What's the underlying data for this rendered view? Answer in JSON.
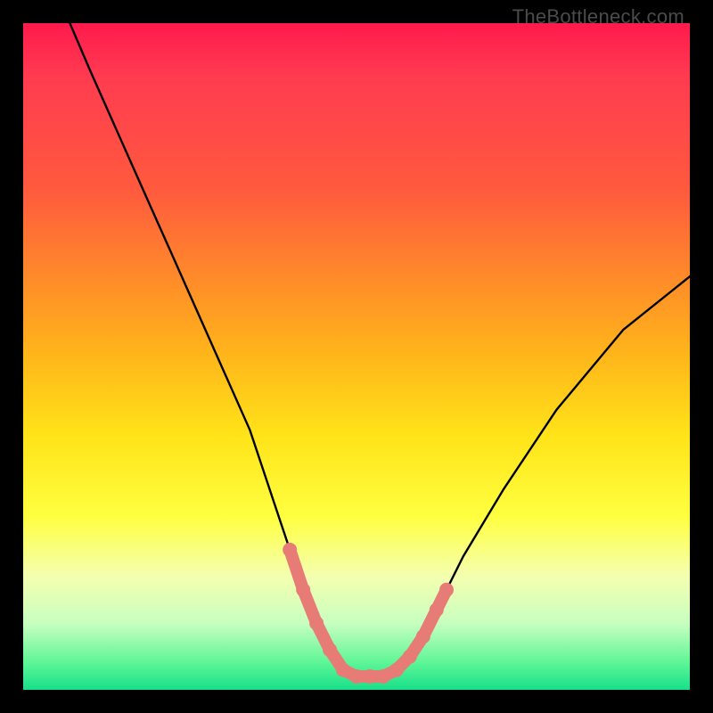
{
  "watermark": "TheBottleneck.com",
  "chart_data": {
    "type": "line",
    "title": "",
    "xlabel": "",
    "ylabel": "",
    "xlim": [
      0,
      100
    ],
    "ylim": [
      0,
      100
    ],
    "background_gradient_stops": [
      {
        "pos": 0,
        "color": "#ff1a4d"
      },
      {
        "pos": 8,
        "color": "#ff3b50"
      },
      {
        "pos": 25,
        "color": "#ff5a3e"
      },
      {
        "pos": 38,
        "color": "#ff8a2a"
      },
      {
        "pos": 50,
        "color": "#ffb61a"
      },
      {
        "pos": 62,
        "color": "#ffe419"
      },
      {
        "pos": 74,
        "color": "#ffff40"
      },
      {
        "pos": 83,
        "color": "#f4ffb0"
      },
      {
        "pos": 90,
        "color": "#c8ffc0"
      },
      {
        "pos": 96,
        "color": "#5cf596"
      },
      {
        "pos": 100,
        "color": "#17e08a"
      }
    ],
    "series": [
      {
        "name": "bottleneck-curve",
        "color": "#000000",
        "x": [
          7,
          10,
          14,
          18,
          22,
          26,
          30,
          34,
          36,
          38,
          40,
          42,
          44,
          46,
          48,
          50,
          52,
          54,
          56,
          58,
          60,
          62,
          66,
          72,
          80,
          90,
          100
        ],
        "y": [
          100,
          93,
          84,
          75,
          66,
          57,
          48,
          39,
          33,
          27,
          21,
          15,
          10,
          6,
          3,
          2,
          2,
          2,
          3,
          5,
          8,
          12,
          20,
          30,
          42,
          54,
          62
        ]
      }
    ],
    "marker_groups": [
      {
        "name": "trough-markers",
        "color": "#e77b76",
        "points": [
          {
            "x": 40,
            "y": 21
          },
          {
            "x": 42,
            "y": 15
          },
          {
            "x": 44,
            "y": 10
          },
          {
            "x": 46,
            "y": 6
          },
          {
            "x": 48,
            "y": 3
          },
          {
            "x": 50,
            "y": 2
          },
          {
            "x": 52,
            "y": 2
          },
          {
            "x": 54,
            "y": 2
          },
          {
            "x": 56,
            "y": 3
          },
          {
            "x": 58,
            "y": 5
          },
          {
            "x": 60,
            "y": 8
          },
          {
            "x": 62,
            "y": 12
          },
          {
            "x": 63.5,
            "y": 15
          }
        ]
      }
    ]
  }
}
